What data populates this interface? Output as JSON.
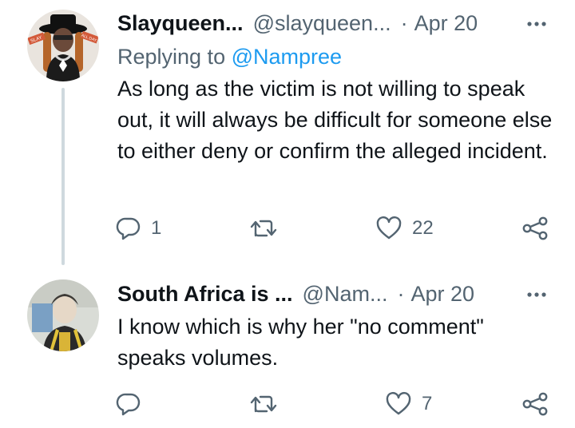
{
  "tweets": [
    {
      "name": "Slayqueen...",
      "handle": "@slayqueen...",
      "dot": "·",
      "date": "Apr 20",
      "replying_prefix": "Replying to ",
      "replying_to": "@Nampree",
      "text": "As long as the victim is not willing to speak out, it will always be difficult for someone else to either deny or confirm the alleged incident.",
      "avatar_badge_left": "SLAY",
      "avatar_badge_right": "ALL DAY",
      "reply_count": "1",
      "retweet_count": "",
      "like_count": "22"
    },
    {
      "name": "South Africa is ...",
      "handle": "@Nam...",
      "dot": "·",
      "date": "Apr 20",
      "text": "I know which is why her \"no comment\" speaks volumes.",
      "reply_count": "",
      "retweet_count": "",
      "like_count": "7"
    }
  ],
  "icons": {
    "more": "more-dots-icon",
    "reply": "reply-bubble-icon",
    "retweet": "retweet-icon",
    "like": "heart-icon",
    "share": "share-icon"
  },
  "colors": {
    "text": "#0f1419",
    "secondary": "#536471",
    "link": "#1d9bf0",
    "thread_line": "#cfd9de"
  }
}
